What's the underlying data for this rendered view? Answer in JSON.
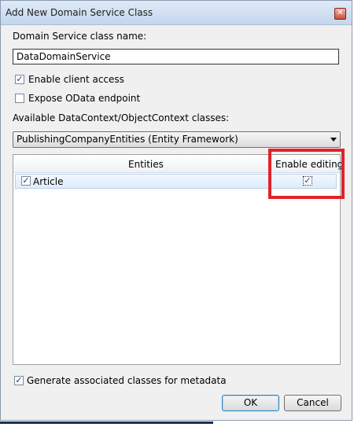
{
  "window": {
    "title": "Add New Domain Service Class"
  },
  "icons": {
    "close": "close-icon"
  },
  "form": {
    "class_name_label": "Domain Service class name:",
    "class_name_value": "DataDomainService",
    "enable_client_access_label": "Enable client access",
    "enable_client_access_checked": true,
    "expose_odata_label": "Expose OData endpoint",
    "expose_odata_checked": false,
    "available_classes_label": "Available DataContext/ObjectContext classes:",
    "selected_class": "PublishingCompanyEntities (Entity Framework)"
  },
  "entities_grid": {
    "columns": [
      "Entities",
      "Enable editing"
    ],
    "rows": [
      {
        "name": "Article",
        "selected": true,
        "enable_editing": true
      }
    ]
  },
  "footer": {
    "generate_metadata_label": "Generate associated classes for metadata",
    "generate_metadata_checked": true,
    "ok_label": "OK",
    "cancel_label": "Cancel"
  },
  "colors": {
    "highlight": "#e2232a",
    "check": "#1b3c8f"
  }
}
